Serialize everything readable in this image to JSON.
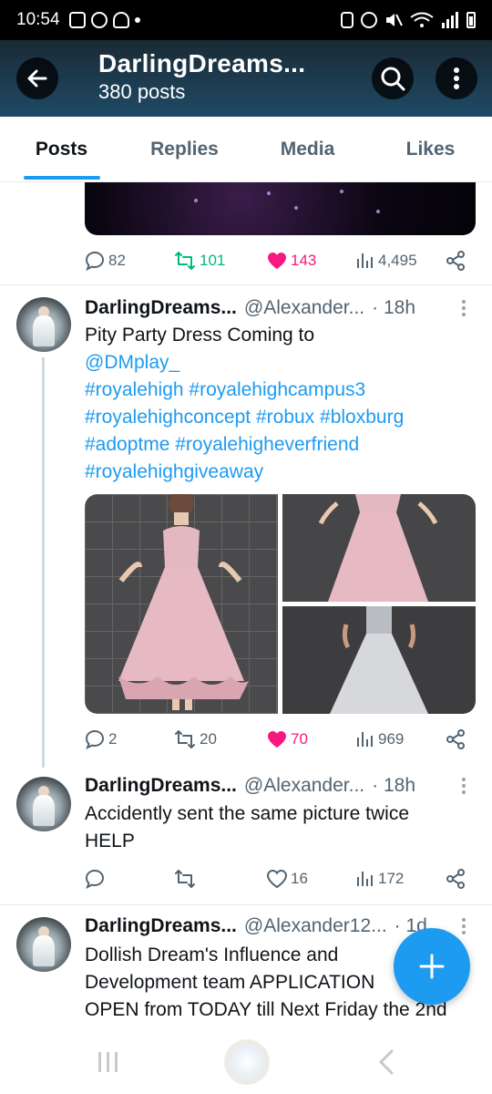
{
  "status_bar": {
    "time": "10:54"
  },
  "header": {
    "title": "DarlingDreams...",
    "subtitle": "380 posts"
  },
  "tabs": [
    {
      "label": "Posts",
      "active": true
    },
    {
      "label": "Replies",
      "active": false
    },
    {
      "label": "Media",
      "active": false
    },
    {
      "label": "Likes",
      "active": false
    }
  ],
  "tweets": [
    {
      "stats": {
        "replies": "82",
        "retweets": "101",
        "likes": "143",
        "views": "4,495"
      }
    },
    {
      "name": "DarlingDreams...",
      "handle": "@Alexander...",
      "time": "· 18h",
      "text_line1": "Pity Party Dress Coming to",
      "links": [
        "@DMplay_",
        "#royalehigh #royalehighcampus3",
        "#royalehighconcept #robux #bloxburg",
        "#adoptme #royalehigheverfriend",
        "#royalehighgiveaway"
      ],
      "stats": {
        "replies": "2",
        "retweets": "20",
        "likes": "70",
        "views": "969"
      }
    },
    {
      "name": "DarlingDreams...",
      "handle": "@Alexander...",
      "time": "· 18h",
      "text_line1": "Accidently sent the same picture twice",
      "text_line2": "HELP",
      "stats": {
        "replies": "",
        "retweets": "",
        "likes": "16",
        "views": "172"
      }
    },
    {
      "name": "DarlingDreams...",
      "handle": "@Alexander12...",
      "time": "· 1d",
      "text_line1": "Dollish Dream's Influence and",
      "text_line2": "Development team APPLICATION",
      "text_line3": "OPEN from TODAY till Next Friday the 2nd"
    }
  ],
  "colors": {
    "accent": "#1d9bf0",
    "like": "#f91880",
    "retweet": "#00ba7c",
    "header_bg": "#1f4a66"
  },
  "icons": [
    "back-arrow-icon",
    "search-icon",
    "more-vertical-icon",
    "reply-icon",
    "retweet-icon",
    "heart-icon",
    "views-icon",
    "share-icon",
    "compose-plus-icon"
  ]
}
